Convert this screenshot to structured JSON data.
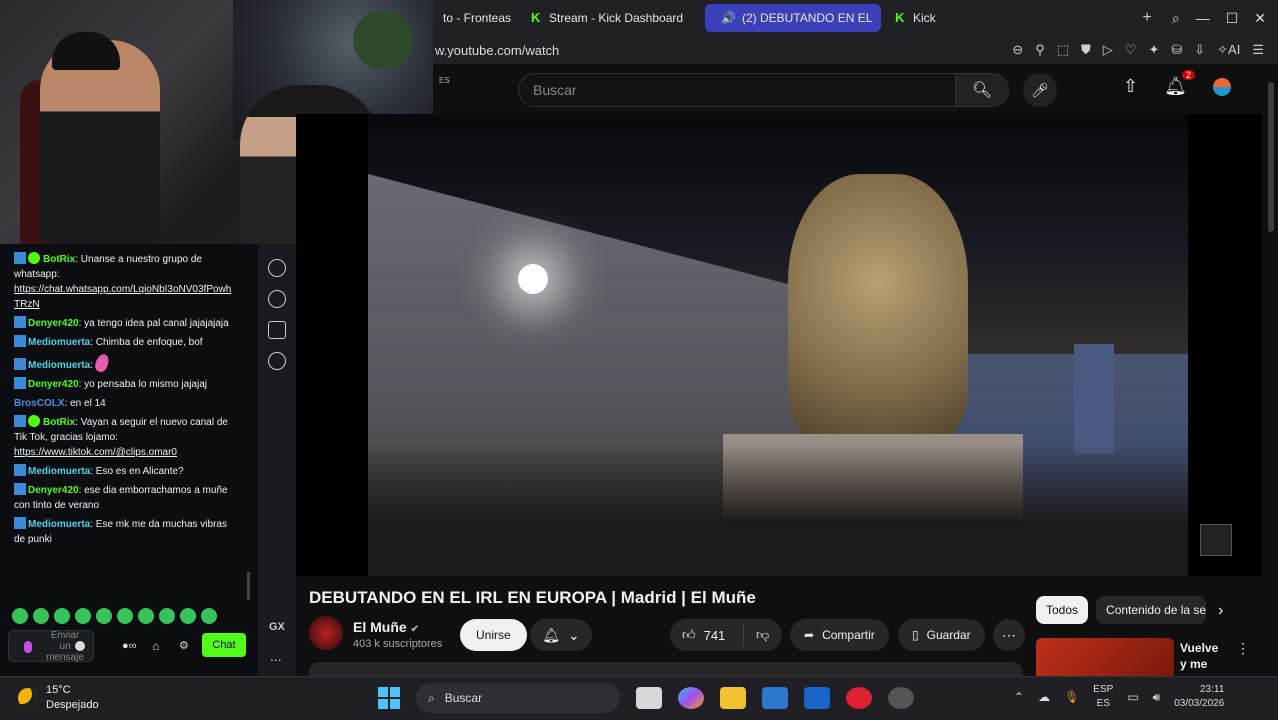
{
  "browser": {
    "tabs": [
      {
        "label": "to - Fronteas",
        "active": false
      },
      {
        "label": "Stream - Kick Dashboard",
        "active": false
      },
      {
        "label": "(2) DEBUTANDO EN EL",
        "active": true
      },
      {
        "label": "Kick",
        "active": false
      }
    ],
    "new_tab": "+",
    "url": "w.youtube.com/watch"
  },
  "youtube": {
    "region": "ES",
    "search_placeholder": "Buscar",
    "notification_count": "2",
    "video_title": "DEBUTANDO EN EL IRL EN EUROPA | Madrid | El Muñe",
    "channel_name": "El Muñe",
    "subscribers": "403 k suscriptores",
    "join_label": "Unirse",
    "likes": "741",
    "share_label": "Compartir",
    "save_label": "Guardar",
    "chips": [
      "Todos",
      "Contenido de la se"
    ],
    "recommended_title": "Vuelve y me pa..."
  },
  "chat": {
    "messages": [
      {
        "user": "BotRix",
        "color": "#53fc18",
        "verified": true,
        "text": "Unanse a nuestro grupo de whatsapp:",
        "link": "https://chat.whatsapp.com/LqioNbI3oNV03fPowhTRzN"
      },
      {
        "user": "Denyer420",
        "color": "#53fc18",
        "verified": false,
        "text": "ya tengo idea pal canal jajajajaja",
        "link": ""
      },
      {
        "user": "Mediomuerta",
        "color": "#4fd1e8",
        "verified": false,
        "text": "Chimba de enfoque, bof",
        "link": ""
      },
      {
        "user": "Mediomuerta",
        "color": "#4fd1e8",
        "verified": false,
        "text": "",
        "link": "",
        "emote": true
      },
      {
        "user": "Denyer420",
        "color": "#53fc18",
        "verified": false,
        "text": "yo pensaba lo mismo jajajaj",
        "link": ""
      },
      {
        "user": "BrosCOLX",
        "color": "#4a90e2",
        "verified": false,
        "text": "en el 14",
        "link": "",
        "no_badge": true
      },
      {
        "user": "BotRix",
        "color": "#53fc18",
        "verified": true,
        "text": "Vayan a seguir el nuevo canal de Tik Tok, gracias lojamo:",
        "link": "https://www.tiktok.com/@clips.omar0"
      },
      {
        "user": "Mediomuerta",
        "color": "#4fd1e8",
        "verified": false,
        "text": "Eso es en Alicante?",
        "link": ""
      },
      {
        "user": "Denyer420",
        "color": "#53fc18",
        "verified": false,
        "text": "ese dia emborrachamos a muñe con tinto de verano",
        "link": ""
      },
      {
        "user": "Mediomuerta",
        "color": "#4fd1e8",
        "verified": false,
        "text": "Ese mk me da muchas vibras de punki",
        "link": ""
      }
    ],
    "input_placeholder": "Enviar un mensaje",
    "send_label": "Chat",
    "sidebar_gx": "GX",
    "sidebar_more": "..."
  },
  "taskbar": {
    "temperature": "15°C",
    "weather": "Despejado",
    "search_label": "Buscar",
    "lang_top": "ESP",
    "lang_bottom": "ES",
    "time": "23:11",
    "date": "03/03/2026"
  },
  "colors": {
    "kick_green": "#53fc18",
    "yt_red": "#ff0000",
    "active_tab": "#3b3fb8"
  }
}
